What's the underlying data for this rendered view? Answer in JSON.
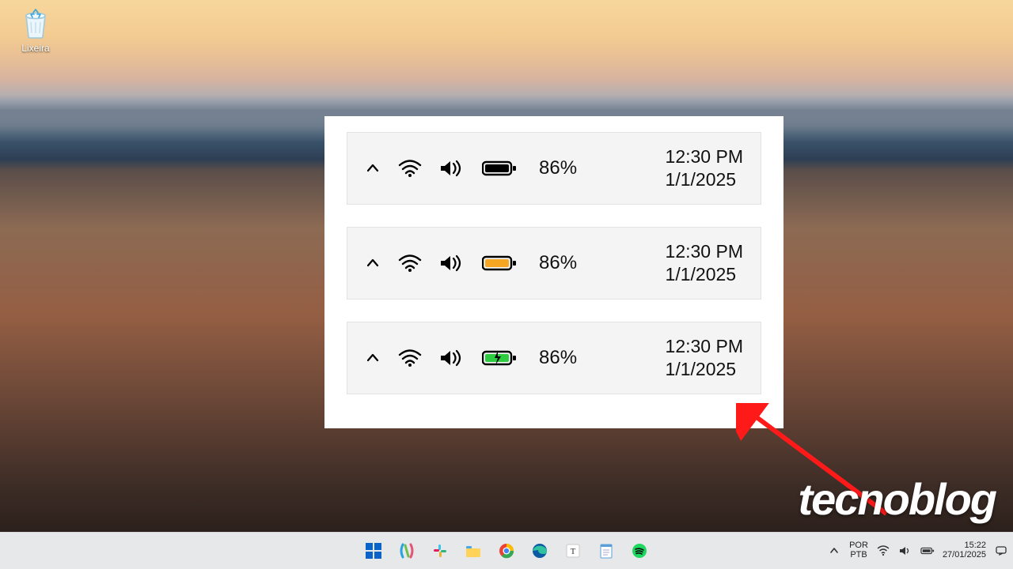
{
  "desktop": {
    "recycle_bin_label": "Lixeira"
  },
  "card": {
    "samples": [
      {
        "battery_color": "#000000",
        "charging": false,
        "percent": "86%",
        "time": "12:30 PM",
        "date": "1/1/2025"
      },
      {
        "battery_color": "#f5a623",
        "charging": false,
        "percent": "86%",
        "time": "12:30 PM",
        "date": "1/1/2025"
      },
      {
        "battery_color": "#2ecc40",
        "charging": true,
        "percent": "86%",
        "time": "12:30 PM",
        "date": "1/1/2025"
      }
    ]
  },
  "watermark": {
    "text": "tecnoblog"
  },
  "taskbar": {
    "lang_line1": "POR",
    "lang_line2": "PTB",
    "time": "15:22",
    "date": "27/01/2025"
  }
}
